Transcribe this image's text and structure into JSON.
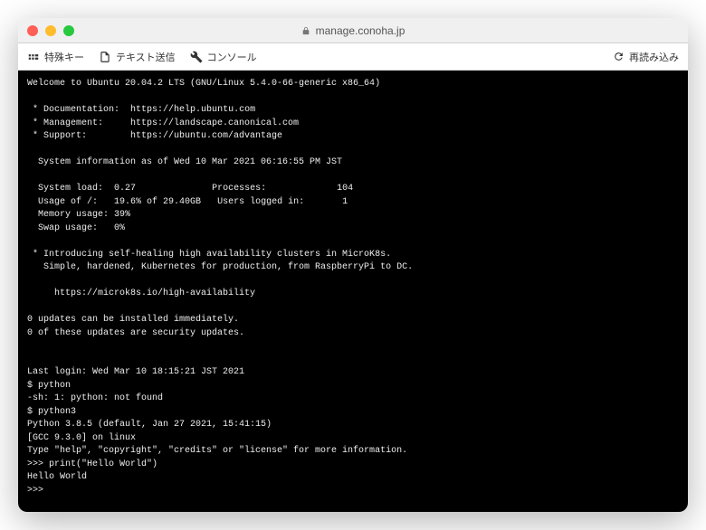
{
  "titlebar": {
    "url": "manage.conoha.jp"
  },
  "toolbar": {
    "special_keys": "特殊キー",
    "text_send": "テキスト送信",
    "console": "コンソール",
    "reload": "再読み込み"
  },
  "terminal": {
    "welcome": "Welcome to Ubuntu 20.04.2 LTS (GNU/Linux 5.4.0-66-generic x86_64)",
    "links": {
      "doc_label": " * Documentation:",
      "doc_url": "https://help.ubuntu.com",
      "mgmt_label": " * Management:",
      "mgmt_url": "https://landscape.canonical.com",
      "sup_label": " * Support:",
      "sup_url": "https://ubuntu.com/advantage"
    },
    "sysinfo_header": "  System information as of Wed 10 Mar 2021 06:16:55 PM JST",
    "sysinfo": {
      "load_label": "  System load:",
      "load": "0.27",
      "processes_label": "Processes:",
      "processes": "104",
      "usage_label": "  Usage of /:",
      "usage": "19.6% of 29.40GB",
      "users_label": "Users logged in:",
      "users": "1",
      "mem_label": "  Memory usage:",
      "mem": "39%",
      "swap_label": "  Swap usage:",
      "swap": "0%"
    },
    "microk8s1": " * Introducing self-healing high availability clusters in MicroK8s.",
    "microk8s2": "   Simple, hardened, Kubernetes for production, from RaspberryPi to DC.",
    "microk8s_url": "     https://microk8s.io/high-availability",
    "updates1": "0 updates can be installed immediately.",
    "updates2": "0 of these updates are security updates.",
    "last_login": "Last login: Wed Mar 10 18:15:21 JST 2021",
    "cmd1": "$ python",
    "notfound": "-sh: 1: python: not found",
    "cmd2": "$ python3",
    "pyver": "Python 3.8.5 (default, Jan 27 2021, 15:41:15)",
    "gcc": "[GCC 9.3.0] on linux",
    "pyhelp": "Type \"help\", \"copyright\", \"credits\" or \"license\" for more information.",
    "pycmd": ">>> print(\"Hello World\")",
    "pyout": "Hello World",
    "prompt": ">>> "
  }
}
